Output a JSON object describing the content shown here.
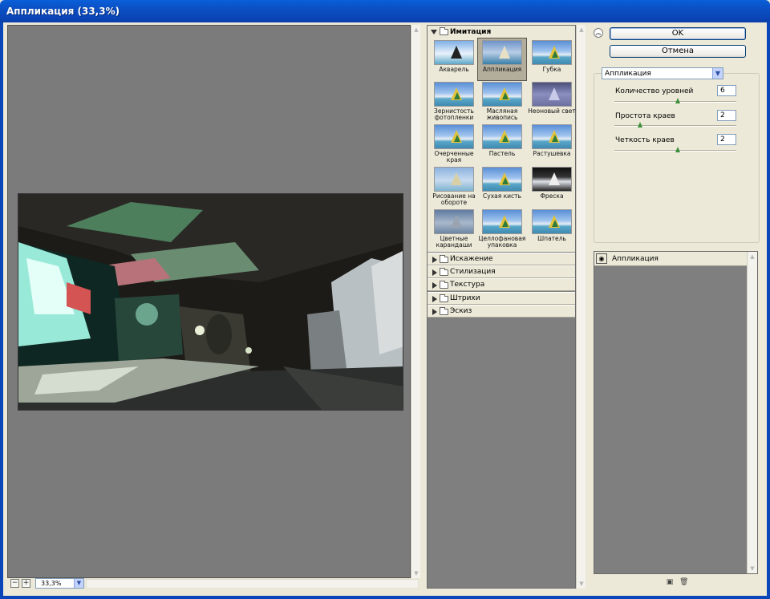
{
  "window": {
    "title": "Аппликация (33,3%)"
  },
  "preview": {
    "zoom_value": "33,3%",
    "zoom_minus": "−",
    "zoom_plus": "+"
  },
  "gallery": {
    "open_group": {
      "label": "Имитация",
      "items": [
        {
          "label": "Акварель"
        },
        {
          "label": "Аппликация",
          "selected": true
        },
        {
          "label": "Губка"
        },
        {
          "label": "Зернистость фотопленки"
        },
        {
          "label": "Масляная живопись"
        },
        {
          "label": "Неоновый свет"
        },
        {
          "label": "Очерченные края"
        },
        {
          "label": "Пастель"
        },
        {
          "label": "Растушевка"
        },
        {
          "label": "Рисование на обороте"
        },
        {
          "label": "Сухая кисть"
        },
        {
          "label": "Фреска"
        },
        {
          "label": "Цветные карандаши"
        },
        {
          "label": "Целлофановая упаковка"
        },
        {
          "label": "Шпатель"
        }
      ]
    },
    "closed_groups": [
      {
        "label": "Искажение"
      },
      {
        "label": "Стилизация"
      },
      {
        "label": "Текстура"
      },
      {
        "label": "Штрихи"
      },
      {
        "label": "Эскиз"
      }
    ]
  },
  "buttons": {
    "ok": "OK",
    "cancel": "Отмена"
  },
  "filter_select": {
    "value": "Аппликация"
  },
  "params": [
    {
      "label": "Количество уровней",
      "value": "6",
      "position": 0.52
    },
    {
      "label": "Простота краев",
      "value": "2",
      "position": 0.2
    },
    {
      "label": "Четкость краев",
      "value": "2",
      "position": 0.52
    }
  ],
  "layers": [
    {
      "name": "Аппликация",
      "visible": true
    }
  ],
  "icons": {
    "collapse": "collapse-up-icon",
    "eye": "eye-icon",
    "new_layer": "new-layer-icon",
    "delete_layer": "trash-icon",
    "folder": "folder-icon"
  }
}
